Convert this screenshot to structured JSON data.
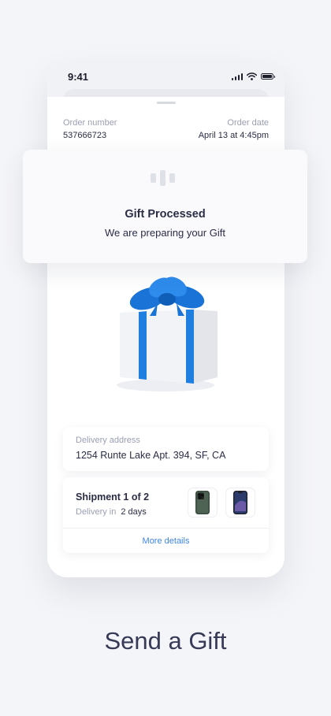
{
  "status_bar": {
    "time": "9:41"
  },
  "order": {
    "number_label": "Order number",
    "number_value": "537666723",
    "date_label": "Order date",
    "date_value": "April 13 at 4:45pm"
  },
  "popup": {
    "title": "Gift Processed",
    "subtitle": "We are preparing your Gift"
  },
  "delivery": {
    "label": "Delivery address",
    "address": "1254 Runte Lake Apt. 394, SF, CA"
  },
  "shipment": {
    "title": "Shipment 1 of 2",
    "delivery_label": "Delivery in",
    "delivery_days": "2 days",
    "items": [
      "iphone-green-icon",
      "iphone-silver-icon"
    ],
    "more_label": "More details"
  },
  "footer": {
    "title": "Send a Gift"
  },
  "colors": {
    "accent": "#3d86e8",
    "ribbon": "#1f7fe0",
    "text": "#2a2d45",
    "muted": "#9a9fb3"
  }
}
